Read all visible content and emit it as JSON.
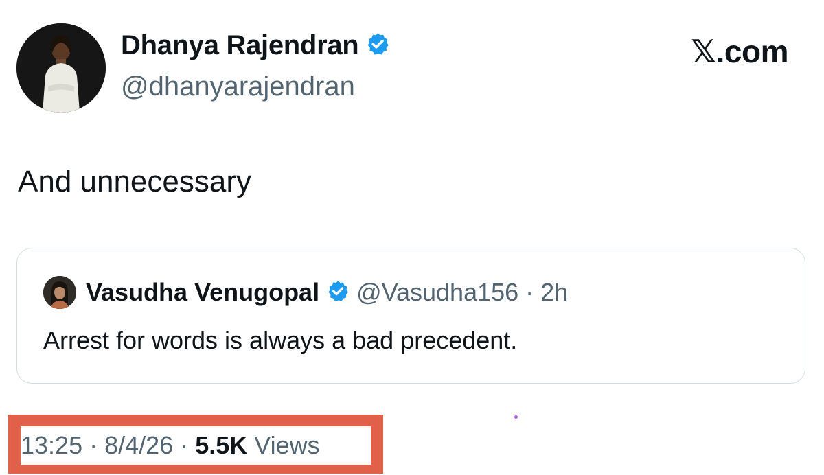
{
  "author": {
    "name": "Dhanya Rajendran",
    "handle": "@dhanyarajendran",
    "verified": true
  },
  "brand": "𝕏.com",
  "tweet_text": "And unnecessary",
  "quoted_tweet": {
    "name": "Vasudha Venugopal",
    "handle": "@Vasudha156",
    "separator": "·",
    "time": "2h",
    "verified": true,
    "text": "Arrest for words is always a bad precedent."
  },
  "meta": {
    "time": "13:25",
    "separator": " · ",
    "date": "8/4/26",
    "views_count": "5.5K",
    "views_label": " Views"
  },
  "colors": {
    "verified_badge": "#1d9bf0",
    "highlight_box": "#e0604a",
    "secondary_text": "#536471"
  }
}
